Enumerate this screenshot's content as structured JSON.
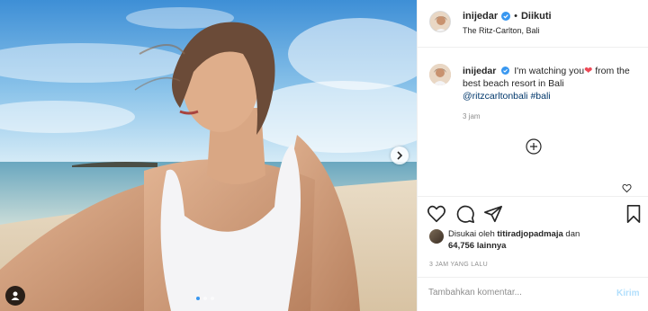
{
  "post": {
    "username": "inijedar",
    "follow_separator": "•",
    "follow_label": "Diikuti",
    "location": "The Ritz-Carlton, Bali",
    "image_description_icon": "user-tag-icon",
    "carousel": {
      "total": 3,
      "active": 1
    }
  },
  "caption": {
    "username": "inijedar",
    "text_before_heart": "I'm watching you",
    "heart": "❤",
    "text_after_heart": " from the best beach resort in Bali",
    "mention": "@ritzcarltonbali",
    "hashtag": "#bali",
    "time": "3 jam"
  },
  "actions": {
    "liked_by_prefix": "Disukai oleh",
    "liked_by_user": "titiradjopadmaja",
    "liked_by_conj": "dan",
    "likes_count": "64,756",
    "likes_suffix": "lainnya",
    "timestamp": "3 JAM YANG LALU"
  },
  "comment": {
    "placeholder": "Tambahkan komentar...",
    "send_label": "Kirim"
  },
  "colors": {
    "verified": "#3897f0",
    "link": "#00376b",
    "muted": "#8e8e8e",
    "send_disabled": "#b2dffc"
  }
}
